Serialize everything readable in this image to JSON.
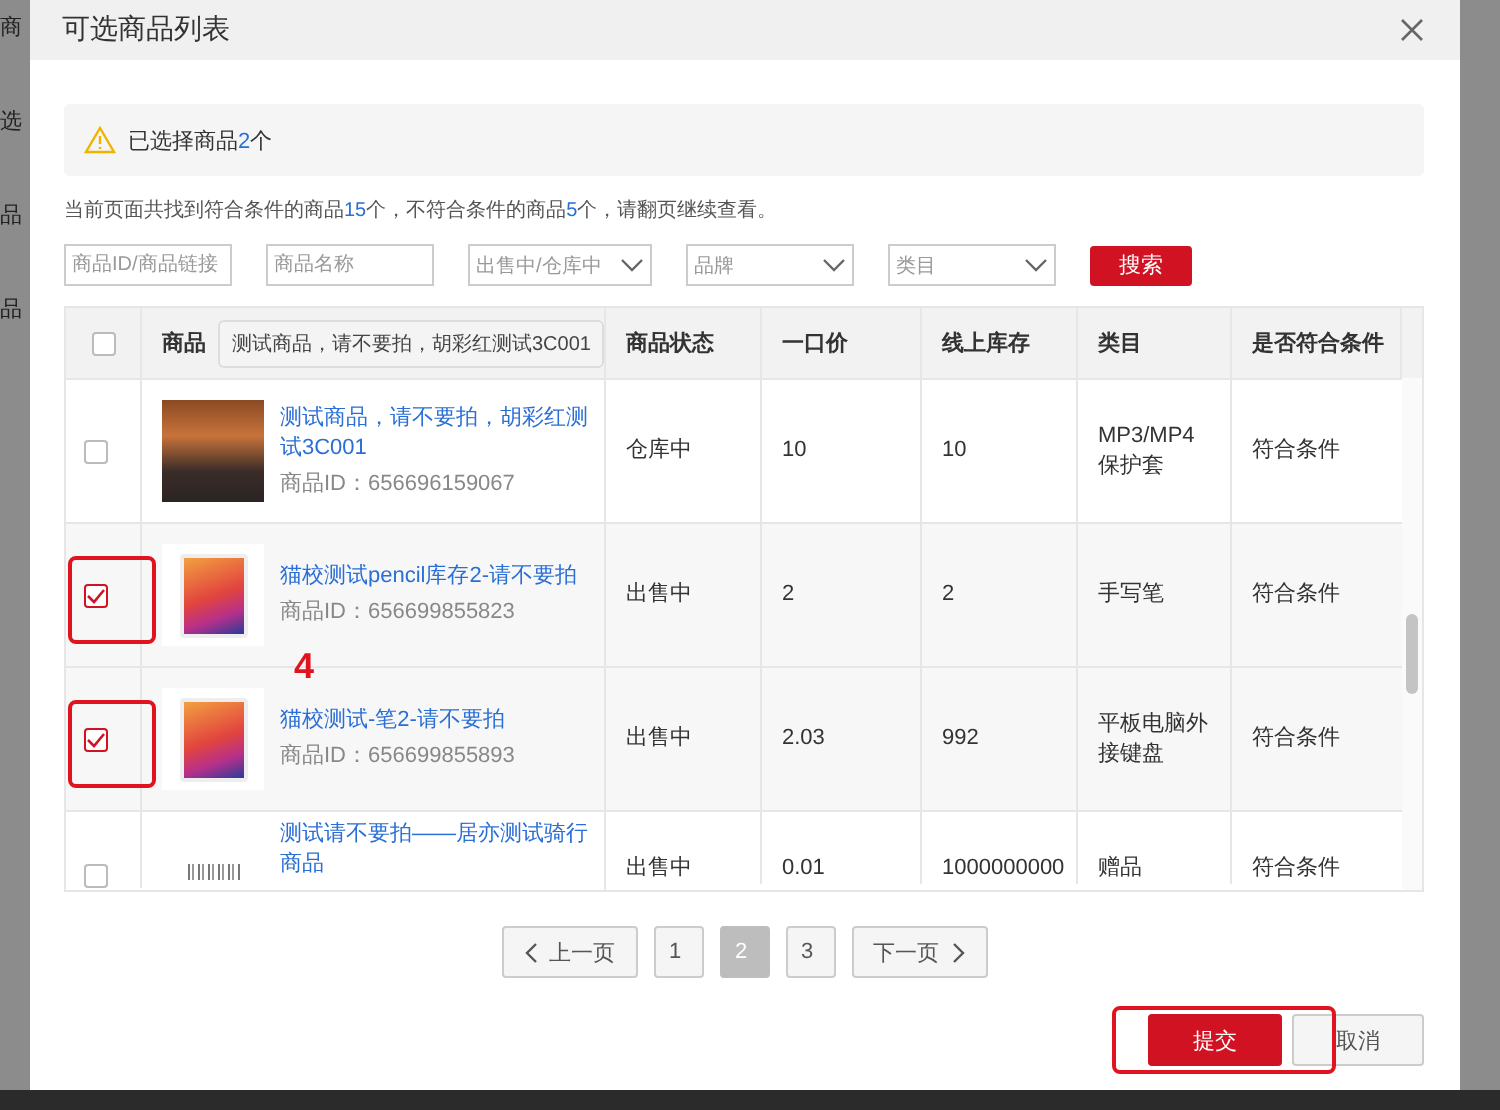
{
  "background": {
    "fragments": [
      "商",
      "选",
      "品",
      "品"
    ]
  },
  "dialog": {
    "title": "可选商品列表"
  },
  "alert": {
    "segments": [
      {
        "text": "已选择商品",
        "highlight": false
      },
      {
        "text": "2",
        "highlight": true
      },
      {
        "text": "个",
        "highlight": false
      }
    ]
  },
  "info": {
    "segments": [
      {
        "text": "当前页面共找到符合条件的商品",
        "highlight": false
      },
      {
        "text": "15",
        "highlight": true
      },
      {
        "text": "个，不符合条件的商品",
        "highlight": false
      },
      {
        "text": "5",
        "highlight": true
      },
      {
        "text": "个，请翻页继续查看。",
        "highlight": false
      }
    ]
  },
  "filters": [
    {
      "kind": "input",
      "placeholder": "商品ID/商品链接"
    },
    {
      "kind": "input",
      "placeholder": "商品名称"
    },
    {
      "kind": "select",
      "placeholder": "出售中/仓库中"
    },
    {
      "kind": "select",
      "placeholder": "品牌"
    },
    {
      "kind": "select",
      "placeholder": "类目"
    }
  ],
  "search_button": "搜索",
  "table": {
    "select_all_checked": false,
    "columns": [
      "商品",
      "商品状态",
      "一口价",
      "线上库存",
      "类目",
      "是否符合条件"
    ],
    "rows": [
      {
        "checked": false,
        "annotated": false,
        "kind": "photo",
        "title": "测试商品，请不要拍，胡彩红测试3C001",
        "product_id": "商品ID：656696159067",
        "status": "仓库中",
        "price": "10",
        "stock": "10",
        "category": "MP3/MP4保护套",
        "eligible": "符合条件"
      },
      {
        "checked": true,
        "annotated": true,
        "kind": "tablet",
        "title": "猫校测试pencil库存2-请不要拍",
        "product_id": "商品ID：656699855823",
        "status": "出售中",
        "price": "2",
        "stock": "2",
        "category": "手写笔",
        "eligible": "符合条件"
      },
      {
        "checked": true,
        "annotated": true,
        "kind": "tablet",
        "title": "猫校测试-笔2-请不要拍",
        "product_id": "商品ID：656699855893",
        "status": "出售中",
        "price": "2.03",
        "stock": "992",
        "category": "平板电脑外接键盘",
        "eligible": "符合条件"
      },
      {
        "checked": false,
        "annotated": false,
        "kind": "barcode",
        "title": "测试请不要拍——居亦测试骑行商品",
        "status": "出售中",
        "price": "0.01",
        "stock": "1000000000",
        "category": "赠品",
        "eligible": "符合条件"
      }
    ]
  },
  "tooltip": "测试商品，请不要拍，胡彩红测试3C001",
  "annotation_label": "4",
  "pagination": {
    "prev": "上一页",
    "next": "下一页",
    "pages": [
      {
        "label": "1",
        "selected": false
      },
      {
        "label": "2",
        "selected": true
      },
      {
        "label": "3",
        "selected": false
      }
    ]
  },
  "footer": {
    "submit": "提交",
    "submit_annotated": true,
    "cancel": "取消"
  }
}
